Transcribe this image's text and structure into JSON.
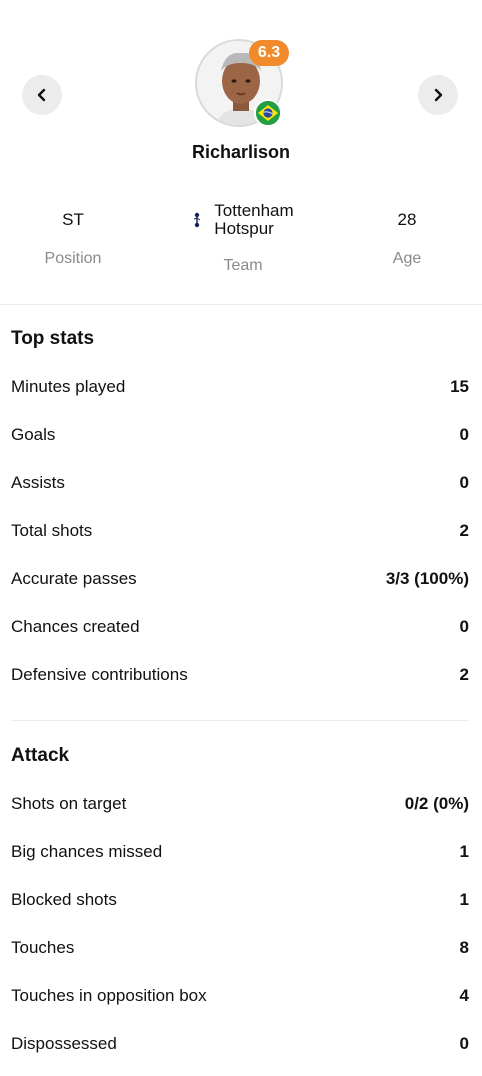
{
  "player": {
    "name": "Richarlison",
    "rating": "6.3",
    "nationality_flag": "brazil-flag-icon",
    "rating_color": "#f08a2b"
  },
  "info": {
    "position_value": "ST",
    "position_label": "Position",
    "team_value_line1": "Tottenham",
    "team_value_line2": "Hotspur",
    "team_label": "Team",
    "age_value": "28",
    "age_label": "Age"
  },
  "top_stats": {
    "title": "Top stats",
    "rows": [
      {
        "label": "Minutes played",
        "value": "15"
      },
      {
        "label": "Goals",
        "value": "0"
      },
      {
        "label": "Assists",
        "value": "0"
      },
      {
        "label": "Total shots",
        "value": "2"
      },
      {
        "label": "Accurate passes",
        "value": "3/3 (100%)"
      },
      {
        "label": "Chances created",
        "value": "0"
      },
      {
        "label": "Defensive contributions",
        "value": "2"
      }
    ]
  },
  "attack": {
    "title": "Attack",
    "rows": [
      {
        "label": "Shots on target",
        "value": "0/2 (0%)"
      },
      {
        "label": "Big chances missed",
        "value": "1"
      },
      {
        "label": "Blocked shots",
        "value": "1"
      },
      {
        "label": "Touches",
        "value": "8"
      },
      {
        "label": "Touches in opposition box",
        "value": "4"
      },
      {
        "label": "Dispossessed",
        "value": "0"
      }
    ]
  }
}
